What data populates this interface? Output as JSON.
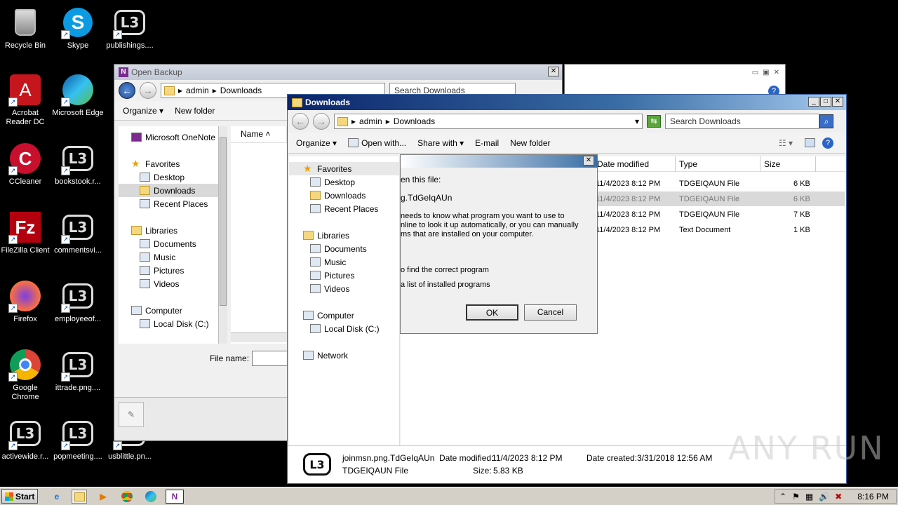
{
  "desktop": {
    "icons": [
      {
        "label": "Recycle Bin",
        "icon": "recycle-bin-icon"
      },
      {
        "label": "Skype",
        "icon": "skype-icon"
      },
      {
        "label": "publishings....",
        "icon": "lb3-file-icon"
      },
      {
        "label": "Acrobat Reader DC",
        "icon": "acrobat-icon"
      },
      {
        "label": "Microsoft Edge",
        "icon": "edge-icon"
      },
      {
        "label": "CCleaner",
        "icon": "ccleaner-icon"
      },
      {
        "label": "bookstook.r...",
        "icon": "lb3-file-icon"
      },
      {
        "label": "FileZilla Client",
        "icon": "filezilla-icon"
      },
      {
        "label": "commentsvi...",
        "icon": "lb3-file-icon"
      },
      {
        "label": "Firefox",
        "icon": "firefox-icon"
      },
      {
        "label": "employeeof...",
        "icon": "lb3-file-icon"
      },
      {
        "label": "Google Chrome",
        "icon": "chrome-icon"
      },
      {
        "label": "ittrade.png....",
        "icon": "lb3-file-icon"
      },
      {
        "label": "activewide.r...",
        "icon": "lb3-file-icon"
      },
      {
        "label": "popmeeting....",
        "icon": "lb3-file-icon"
      },
      {
        "label": "usblittle.pn...",
        "icon": "lb3-file-icon"
      }
    ]
  },
  "open_backup": {
    "title": "Open Backup",
    "breadcrumb": [
      "admin",
      "Downloads"
    ],
    "search_placeholder": "Search Downloads",
    "toolbar": {
      "organize": "Organize",
      "new_folder": "New folder"
    },
    "nav": {
      "onenote": "Microsoft OneNote",
      "favorites": "Favorites",
      "desktop": "Desktop",
      "downloads": "Downloads",
      "recent": "Recent Places",
      "libraries": "Libraries",
      "documents": "Documents",
      "music": "Music",
      "pictures": "Pictures",
      "videos": "Videos",
      "computer": "Computer",
      "local_disk": "Local Disk (C:)"
    },
    "column_name": "Name",
    "file_name_label": "File name:"
  },
  "downloads": {
    "title": "Downloads",
    "breadcrumb": [
      "admin",
      "Downloads"
    ],
    "search_placeholder": "Search Downloads",
    "toolbar": {
      "organize": "Organize",
      "open_with": "Open with...",
      "share_with": "Share with",
      "email": "E-mail",
      "new_folder": "New folder"
    },
    "nav": {
      "favorites": "Favorites",
      "desktop": "Desktop",
      "downloads": "Downloads",
      "recent": "Recent Places",
      "libraries": "Libraries",
      "documents": "Documents",
      "music": "Music",
      "pictures": "Pictures",
      "videos": "Videos",
      "computer": "Computer",
      "local_disk": "Local Disk (C:)",
      "network": "Network"
    },
    "columns": {
      "date": "Date modified",
      "type": "Type",
      "size": "Size"
    },
    "files": [
      {
        "date": "11/4/2023 8:12 PM",
        "type": "TDGEIQAUN File",
        "size": "6 KB"
      },
      {
        "date": "11/4/2023 8:12 PM",
        "type": "TDGEIQAUN File",
        "size": "6 KB"
      },
      {
        "date": "11/4/2023 8:12 PM",
        "type": "TDGEIQAUN File",
        "size": "7 KB"
      },
      {
        "date": "11/4/2023 8:12 PM",
        "type": "Text Document",
        "size": "1 KB"
      }
    ],
    "details": {
      "file_name": "joinmsn.png.TdGeIqAUn",
      "date_modified_label": "Date modified:",
      "date_modified": "11/4/2023 8:12 PM",
      "date_created_label": "Date created:",
      "date_created": "3/31/2018 12:56 AM",
      "type": "TDGEIQAUN File",
      "size_label": "Size:",
      "size": "5.83 KB"
    }
  },
  "dialog": {
    "line1": "en this file:",
    "line2": "g.TdGeIqAUn",
    "para": [
      "needs to know what program you want to use to",
      "nline to look it up automatically, or you can manually",
      "ms that are installed on your computer."
    ],
    "option1": "o find the correct program",
    "option2": "a list of installed programs",
    "ok": "OK",
    "cancel": "Cancel"
  },
  "taskbar": {
    "start": "Start",
    "time": "8:16 PM"
  },
  "watermark": "ANY RUN"
}
